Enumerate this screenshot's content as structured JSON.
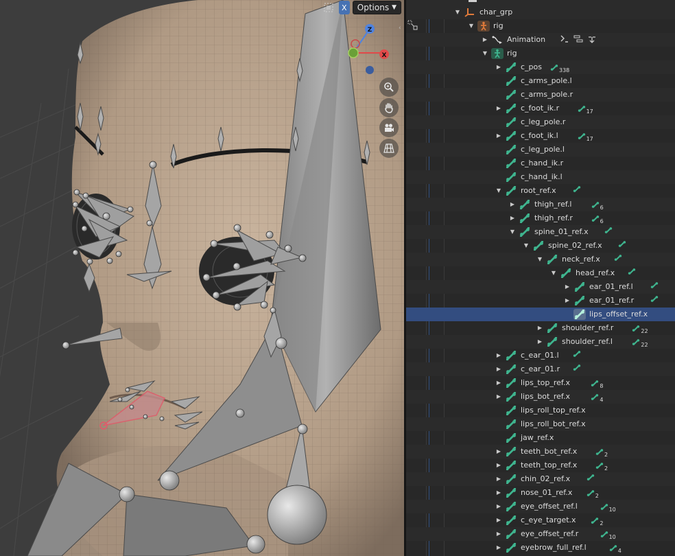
{
  "viewport": {
    "header": {
      "options_label": "Options",
      "x_label": "X"
    },
    "gizmo": {
      "z": "Z",
      "x": "X"
    },
    "colors": {
      "bg": "#3d3d3d",
      "skin": "#b9a48f",
      "bone": "#9a9a9a",
      "selected_bone": "#e05a6a"
    },
    "nav_icons": [
      "zoom-icon",
      "hand-icon",
      "camera-icon",
      "grid-icon"
    ]
  },
  "outliner": {
    "colors": {
      "bg": "#282828",
      "selected_row": "#334d80",
      "bone": "#3fb58f",
      "armature": "#e07a3a"
    },
    "rows": [
      {
        "label": "char_grp",
        "icon": "empty",
        "count": "",
        "depth": 0,
        "expand": "open"
      },
      {
        "label": "rig",
        "icon": "armature-object",
        "count": "",
        "depth": 1,
        "expand": "open"
      },
      {
        "label": "Animation",
        "icon": "animation",
        "count": "",
        "depth": 2,
        "expand": "closed"
      },
      {
        "label": "rig",
        "icon": "armature-data",
        "count": "",
        "depth": 2,
        "expand": "open"
      },
      {
        "label": "c_pos",
        "icon": "bone",
        "count": "338",
        "depth": 3,
        "expand": "closed"
      },
      {
        "label": "c_arms_pole.l",
        "icon": "bone",
        "count": "",
        "depth": 3,
        "expand": "none"
      },
      {
        "label": "c_arms_pole.r",
        "icon": "bone",
        "count": "",
        "depth": 3,
        "expand": "none"
      },
      {
        "label": "c_foot_ik.r",
        "icon": "bone",
        "count": "17",
        "depth": 3,
        "expand": "closed"
      },
      {
        "label": "c_leg_pole.r",
        "icon": "bone",
        "count": "",
        "depth": 3,
        "expand": "none"
      },
      {
        "label": "c_foot_ik.l",
        "icon": "bone",
        "count": "17",
        "depth": 3,
        "expand": "closed"
      },
      {
        "label": "c_leg_pole.l",
        "icon": "bone",
        "count": "",
        "depth": 3,
        "expand": "none"
      },
      {
        "label": "c_hand_ik.r",
        "icon": "bone",
        "count": "",
        "depth": 3,
        "expand": "none"
      },
      {
        "label": "c_hand_ik.l",
        "icon": "bone",
        "count": "",
        "depth": 3,
        "expand": "none"
      },
      {
        "label": "root_ref.x",
        "icon": "bone",
        "count": "",
        "depth": 3,
        "expand": "open"
      },
      {
        "label": "thigh_ref.l",
        "icon": "bone",
        "count": "6",
        "depth": 4,
        "expand": "closed"
      },
      {
        "label": "thigh_ref.r",
        "icon": "bone",
        "count": "6",
        "depth": 4,
        "expand": "closed"
      },
      {
        "label": "spine_01_ref.x",
        "icon": "bone",
        "count": "",
        "depth": 4,
        "expand": "open"
      },
      {
        "label": "spine_02_ref.x",
        "icon": "bone",
        "count": "",
        "depth": 5,
        "expand": "open"
      },
      {
        "label": "neck_ref.x",
        "icon": "bone",
        "count": "",
        "depth": 6,
        "expand": "open"
      },
      {
        "label": "head_ref.x",
        "icon": "bone",
        "count": "",
        "depth": 7,
        "expand": "open"
      },
      {
        "label": "ear_01_ref.l",
        "icon": "bone",
        "count": "",
        "depth": 8,
        "expand": "closed"
      },
      {
        "label": "ear_01_ref.r",
        "icon": "bone",
        "count": "",
        "depth": 8,
        "expand": "closed"
      },
      {
        "label": "lips_offset_ref.x",
        "icon": "bone",
        "count": "",
        "depth": 8,
        "expand": "none",
        "selected": true
      },
      {
        "label": "shoulder_ref.r",
        "icon": "bone",
        "count": "22",
        "depth": 6,
        "expand": "closed"
      },
      {
        "label": "shoulder_ref.l",
        "icon": "bone",
        "count": "22",
        "depth": 6,
        "expand": "closed"
      },
      {
        "label": "c_ear_01.l",
        "icon": "bone",
        "count": "",
        "depth": 3,
        "expand": "closed"
      },
      {
        "label": "c_ear_01.r",
        "icon": "bone",
        "count": "",
        "depth": 3,
        "expand": "closed"
      },
      {
        "label": "lips_top_ref.x",
        "icon": "bone",
        "count": "8",
        "depth": 3,
        "expand": "closed"
      },
      {
        "label": "lips_bot_ref.x",
        "icon": "bone",
        "count": "4",
        "depth": 3,
        "expand": "closed"
      },
      {
        "label": "lips_roll_top_ref.x",
        "icon": "bone",
        "count": "",
        "depth": 3,
        "expand": "none"
      },
      {
        "label": "lips_roll_bot_ref.x",
        "icon": "bone",
        "count": "",
        "depth": 3,
        "expand": "none"
      },
      {
        "label": "jaw_ref.x",
        "icon": "bone",
        "count": "",
        "depth": 3,
        "expand": "none"
      },
      {
        "label": "teeth_bot_ref.x",
        "icon": "bone",
        "count": "2",
        "depth": 3,
        "expand": "closed"
      },
      {
        "label": "teeth_top_ref.x",
        "icon": "bone",
        "count": "2",
        "depth": 3,
        "expand": "closed"
      },
      {
        "label": "chin_02_ref.x",
        "icon": "bone",
        "count": "",
        "depth": 3,
        "expand": "closed"
      },
      {
        "label": "nose_01_ref.x",
        "icon": "bone",
        "count": "2",
        "depth": 3,
        "expand": "closed"
      },
      {
        "label": "eye_offset_ref.l",
        "icon": "bone",
        "count": "10",
        "depth": 3,
        "expand": "closed"
      },
      {
        "label": "c_eye_target.x",
        "icon": "bone",
        "count": "2",
        "depth": 3,
        "expand": "closed"
      },
      {
        "label": "eye_offset_ref.r",
        "icon": "bone",
        "count": "10",
        "depth": 3,
        "expand": "closed"
      },
      {
        "label": "eyebrow_full_ref.l",
        "icon": "bone",
        "count": "4",
        "depth": 3,
        "expand": "closed"
      }
    ]
  }
}
